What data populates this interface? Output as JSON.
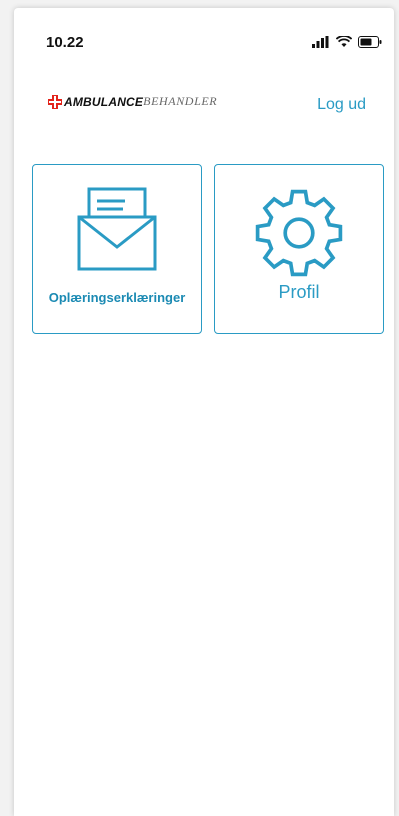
{
  "status_bar": {
    "time": "10.22",
    "icons": [
      "signal-icon",
      "wifi-icon",
      "battery-icon"
    ]
  },
  "header": {
    "logo_bold": "AMBULANCE",
    "logo_light": "BEHANDLER",
    "logout_label": "Log ud"
  },
  "tiles": [
    {
      "label": "Oplæringserklæringer",
      "icon": "envelope-icon"
    },
    {
      "label": "Profil",
      "icon": "gear-icon"
    }
  ],
  "colors": {
    "accent": "#2a9bc4",
    "logo_red": "#e3231b"
  }
}
